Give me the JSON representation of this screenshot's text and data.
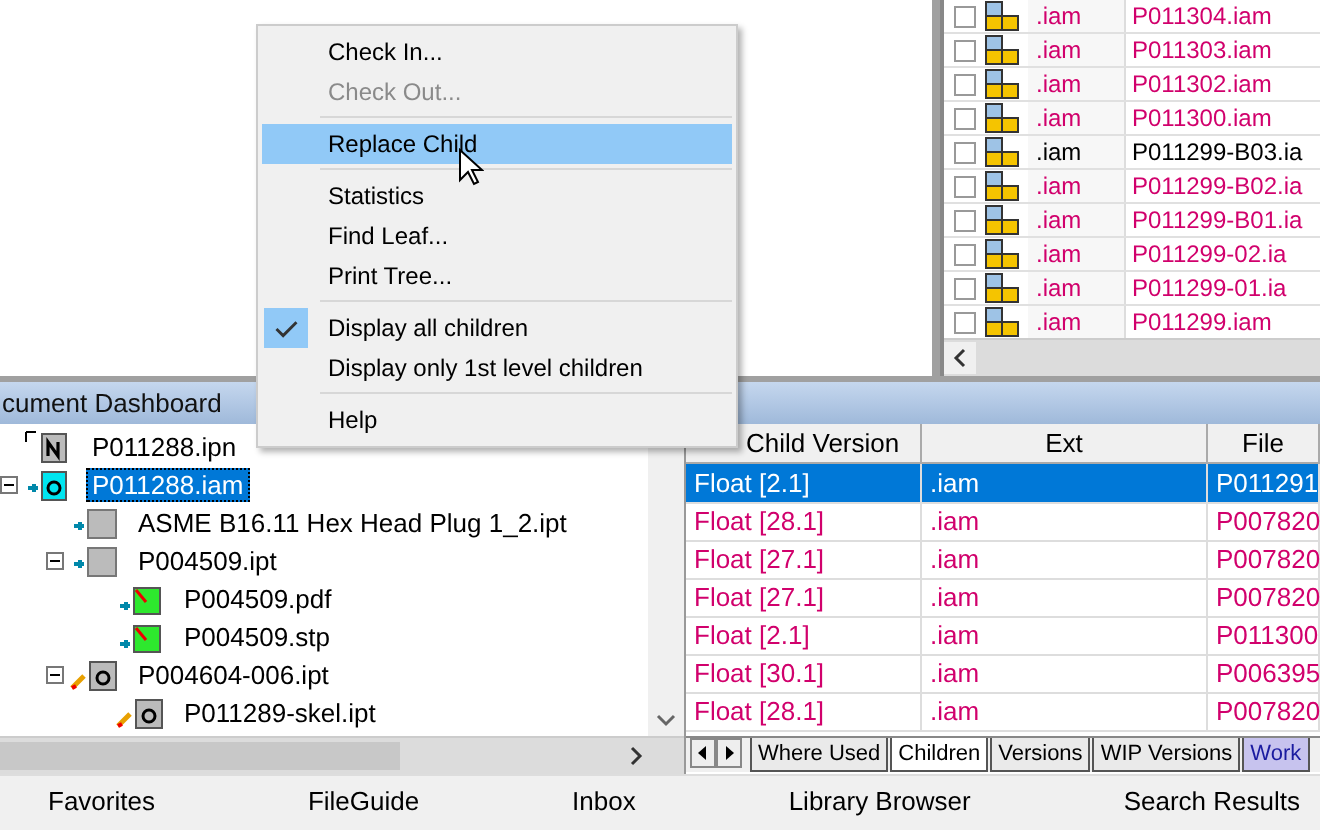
{
  "top_grid": {
    "rows": [
      {
        "ext": ".iam",
        "file": "P011304.iam",
        "color": "#d1006c"
      },
      {
        "ext": ".iam",
        "file": "P011303.iam",
        "color": "#d1006c"
      },
      {
        "ext": ".iam",
        "file": "P011302.iam",
        "color": "#d1006c"
      },
      {
        "ext": ".iam",
        "file": "P011300.iam",
        "color": "#d1006c"
      },
      {
        "ext": ".iam",
        "file": "P011299-B03.ia",
        "color": "#000000"
      },
      {
        "ext": ".iam",
        "file": "P011299-B02.ia",
        "color": "#d1006c"
      },
      {
        "ext": ".iam",
        "file": "P011299-B01.ia",
        "color": "#d1006c"
      },
      {
        "ext": ".iam",
        "file": "P011299-02.ia",
        "color": "#d1006c"
      },
      {
        "ext": ".iam",
        "file": "P011299-01.ia",
        "color": "#d1006c"
      },
      {
        "ext": ".iam",
        "file": "P011299.iam",
        "color": "#d1006c"
      }
    ]
  },
  "dashboard": {
    "title": "cument Dashboard",
    "tree": [
      {
        "label": "P011288.ipn",
        "kind": "presentation",
        "selected": false
      },
      {
        "label": "P011288.iam",
        "kind": "assembly",
        "selected": true,
        "expanded": true,
        "children": [
          {
            "label": "ASME B16.11 Hex Head Plug 1_2.ipt",
            "kind": "part",
            "selected": false
          },
          {
            "label": "P004509.ipt",
            "kind": "part",
            "selected": false,
            "expanded": true,
            "children": [
              {
                "label": "P004509.pdf",
                "kind": "attachment",
                "selected": false
              },
              {
                "label": "P004509.stp",
                "kind": "attachment",
                "selected": false
              }
            ]
          },
          {
            "label": "P004604-006.ipt",
            "kind": "edited",
            "selected": false,
            "expanded": true,
            "children": [
              {
                "label": "P011289-skel.ipt",
                "kind": "edited",
                "selected": false
              }
            ]
          }
        ]
      }
    ],
    "grid": {
      "columns": [
        "Child Version",
        "Ext",
        "File"
      ],
      "rows": [
        {
          "child_version": "Float [2.1]",
          "ext": ".iam",
          "file": "P011291",
          "selected": true
        },
        {
          "child_version": "Float [28.1]",
          "ext": ".iam",
          "file": "P007820",
          "selected": false
        },
        {
          "child_version": "Float [27.1]",
          "ext": ".iam",
          "file": "P007820",
          "selected": false
        },
        {
          "child_version": "Float [27.1]",
          "ext": ".iam",
          "file": "P007820",
          "selected": false
        },
        {
          "child_version": "Float [2.1]",
          "ext": ".iam",
          "file": "P011300",
          "selected": false
        },
        {
          "child_version": "Float [30.1]",
          "ext": ".iam",
          "file": "P006395",
          "selected": false
        },
        {
          "child_version": "Float [28.1]",
          "ext": ".iam",
          "file": "P007820",
          "selected": false
        }
      ]
    },
    "tabs": [
      {
        "label": "Where Used",
        "selected": false
      },
      {
        "label": "Children",
        "selected": true
      },
      {
        "label": "Versions",
        "selected": false
      },
      {
        "label": "WIP Versions",
        "selected": false
      },
      {
        "label": "Work",
        "selected": false
      }
    ]
  },
  "context_menu": {
    "items": [
      {
        "kind": "item",
        "label": "Check In...",
        "disabled": false,
        "selected": false,
        "checked": false
      },
      {
        "kind": "item",
        "label": "Check Out...",
        "disabled": true,
        "selected": false,
        "checked": false
      },
      {
        "kind": "separator"
      },
      {
        "kind": "item",
        "label": "Replace Child",
        "disabled": false,
        "selected": true,
        "checked": false
      },
      {
        "kind": "separator"
      },
      {
        "kind": "item",
        "label": "Statistics",
        "disabled": false,
        "selected": false,
        "checked": false
      },
      {
        "kind": "item",
        "label": "Find Leaf...",
        "disabled": false,
        "selected": false,
        "checked": false
      },
      {
        "kind": "item",
        "label": "Print Tree...",
        "disabled": false,
        "selected": false,
        "checked": false
      },
      {
        "kind": "separator"
      },
      {
        "kind": "item",
        "label": "Display all children",
        "disabled": false,
        "selected": false,
        "checked": true
      },
      {
        "kind": "item",
        "label": "Display only 1st level children",
        "disabled": false,
        "selected": false,
        "checked": false
      },
      {
        "kind": "separator"
      },
      {
        "kind": "item",
        "label": "Help",
        "disabled": false,
        "selected": false,
        "checked": false
      }
    ]
  },
  "bottom_tabs": [
    {
      "label": "Favorites"
    },
    {
      "label": "FileGuide"
    },
    {
      "label": "Inbox"
    },
    {
      "label": "Library Browser"
    },
    {
      "label": "Search Results"
    }
  ]
}
